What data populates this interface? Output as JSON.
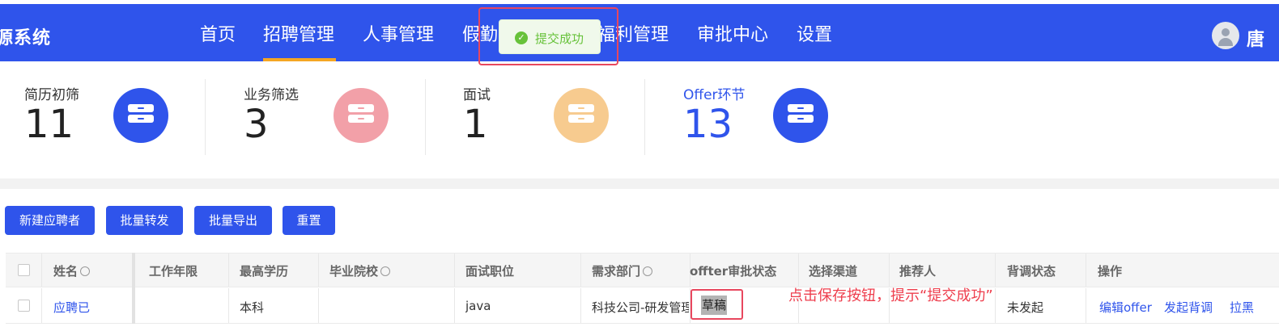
{
  "header": {
    "brand": "源系统",
    "nav": [
      "首页",
      "招聘管理",
      "人事管理",
      "假勤",
      "福利管理",
      "审批中心",
      "设置"
    ],
    "active_nav": "招聘管理",
    "user_name": "唐",
    "accent_color": "#2f54eb",
    "underline_color": "#f5a623"
  },
  "toast": {
    "message": "提交成功",
    "icon": "check-circle-icon",
    "color": "#67c23a"
  },
  "stats": [
    {
      "label": "简历初筛",
      "value": "11",
      "icon": "archive-icon",
      "circle_color": "#2f54eb"
    },
    {
      "label": "业务筛选",
      "value": "3",
      "icon": "archive-icon",
      "circle_color": "#f2a0a8"
    },
    {
      "label": "面试",
      "value": "1",
      "icon": "archive-icon",
      "circle_color": "#f7cb8f"
    },
    {
      "label": "Offer环节",
      "value": "13",
      "icon": "archive-icon",
      "circle_color": "#2f54eb"
    }
  ],
  "toolbar": {
    "new_label": "新建应聘者",
    "transfer_label": "批量转发",
    "export_label": "批量导出",
    "reset_label": "重置"
  },
  "table": {
    "columns": [
      "姓名",
      "工作年限",
      "最高学历",
      "毕业院校",
      "面试职位",
      "需求部门",
      "offter审批状态",
      "选择渠道",
      "推荐人",
      "背调状态",
      "操作"
    ],
    "rows": [
      {
        "name": "应聘已",
        "years": "",
        "education": "本科",
        "school": "",
        "position": "java",
        "department": "科技公司-研发管理",
        "approval_status": "草稿",
        "channel": "",
        "referrer": "",
        "bg_status": "未发起",
        "actions": [
          "编辑offer",
          "发起背调",
          "拉黑"
        ]
      }
    ]
  },
  "annotation": "点击保存按钮，提示“提交成功”"
}
